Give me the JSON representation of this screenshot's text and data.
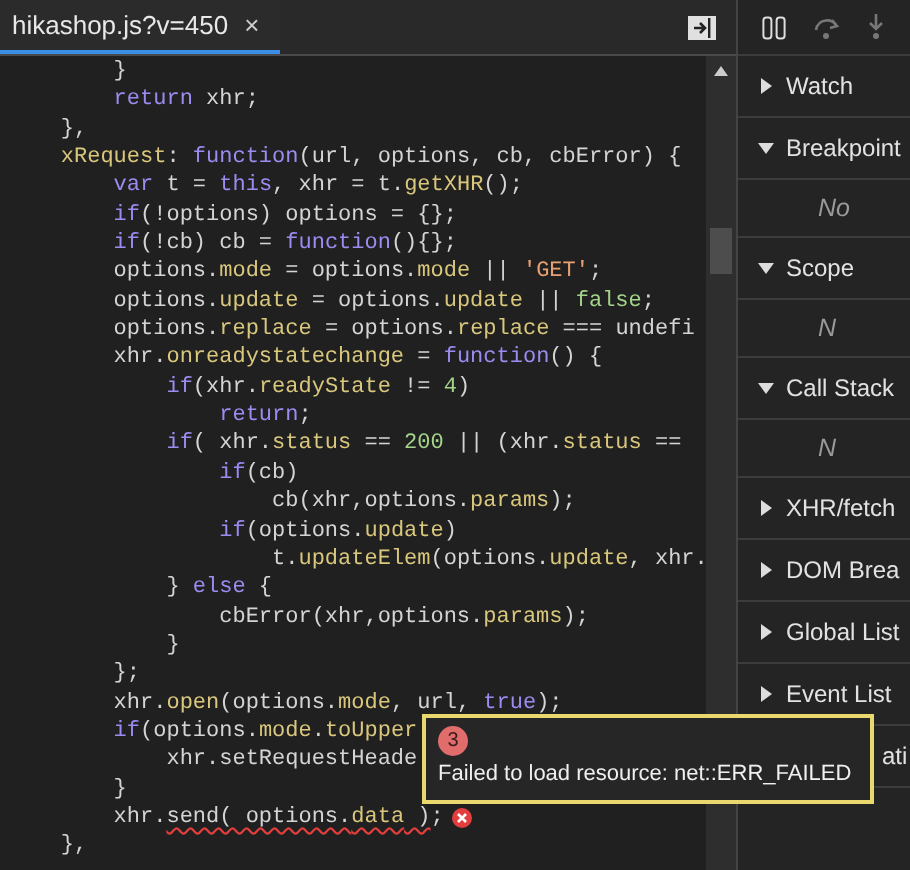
{
  "tab": {
    "label": "hikashop.js?v=450",
    "close": "×",
    "selected": true
  },
  "code": [
    {
      "tokens": [
        {
          "kind": "plain",
          "text": "        }"
        }
      ]
    },
    {
      "tokens": [
        {
          "kind": "keyword",
          "text": "        return"
        },
        {
          "kind": "plain",
          "text": " xhr;"
        }
      ]
    },
    {
      "tokens": [
        {
          "kind": "plain",
          "text": "    },"
        }
      ]
    },
    {
      "tokens": [
        {
          "kind": "member",
          "text": "    xRequest"
        },
        {
          "kind": "plain",
          "text": ": "
        },
        {
          "kind": "keyword",
          "text": "function"
        },
        {
          "kind": "plain",
          "text": "(url, options, cb, cbError) {"
        }
      ]
    },
    {
      "tokens": [
        {
          "kind": "keyword",
          "text": "        var"
        },
        {
          "kind": "plain",
          "text": " t = "
        },
        {
          "kind": "keyword",
          "text": "this"
        },
        {
          "kind": "plain",
          "text": ", xhr = t."
        },
        {
          "kind": "member",
          "text": "getXHR"
        },
        {
          "kind": "plain",
          "text": "();"
        }
      ]
    },
    {
      "tokens": [
        {
          "kind": "keyword",
          "text": "        if"
        },
        {
          "kind": "plain",
          "text": "(!options) options = {};"
        }
      ]
    },
    {
      "tokens": [
        {
          "kind": "keyword",
          "text": "        if"
        },
        {
          "kind": "plain",
          "text": "(!cb) cb = "
        },
        {
          "kind": "keyword",
          "text": "function"
        },
        {
          "kind": "plain",
          "text": "(){};"
        }
      ]
    },
    {
      "tokens": [
        {
          "kind": "plain",
          "text": "        options."
        },
        {
          "kind": "member",
          "text": "mode"
        },
        {
          "kind": "plain",
          "text": " = options."
        },
        {
          "kind": "member",
          "text": "mode"
        },
        {
          "kind": "plain",
          "text": " || "
        },
        {
          "kind": "string",
          "text": "'GET'"
        },
        {
          "kind": "plain",
          "text": ";"
        }
      ]
    },
    {
      "tokens": [
        {
          "kind": "plain",
          "text": "        options."
        },
        {
          "kind": "member",
          "text": "update"
        },
        {
          "kind": "plain",
          "text": " = options."
        },
        {
          "kind": "member",
          "text": "update"
        },
        {
          "kind": "plain",
          "text": " || "
        },
        {
          "kind": "literal",
          "text": "false"
        },
        {
          "kind": "plain",
          "text": ";"
        }
      ]
    },
    {
      "tokens": [
        {
          "kind": "plain",
          "text": "        options."
        },
        {
          "kind": "member",
          "text": "replace"
        },
        {
          "kind": "plain",
          "text": " = options."
        },
        {
          "kind": "member",
          "text": "replace"
        },
        {
          "kind": "plain",
          "text": " === undefi"
        }
      ]
    },
    {
      "tokens": [
        {
          "kind": "plain",
          "text": "        xhr."
        },
        {
          "kind": "member",
          "text": "onreadystatechange"
        },
        {
          "kind": "plain",
          "text": " = "
        },
        {
          "kind": "keyword",
          "text": "function"
        },
        {
          "kind": "plain",
          "text": "() {"
        }
      ]
    },
    {
      "tokens": [
        {
          "kind": "keyword",
          "text": "            if"
        },
        {
          "kind": "plain",
          "text": "(xhr."
        },
        {
          "kind": "member",
          "text": "readyState"
        },
        {
          "kind": "plain",
          "text": " != "
        },
        {
          "kind": "literal",
          "text": "4"
        },
        {
          "kind": "plain",
          "text": ")"
        }
      ]
    },
    {
      "tokens": [
        {
          "kind": "keyword",
          "text": "                return"
        },
        {
          "kind": "plain",
          "text": ";"
        }
      ]
    },
    {
      "tokens": [
        {
          "kind": "keyword",
          "text": "            if"
        },
        {
          "kind": "plain",
          "text": "( xhr."
        },
        {
          "kind": "member",
          "text": "status"
        },
        {
          "kind": "plain",
          "text": " == "
        },
        {
          "kind": "literal",
          "text": "200"
        },
        {
          "kind": "plain",
          "text": " || (xhr."
        },
        {
          "kind": "member",
          "text": "status"
        },
        {
          "kind": "plain",
          "text": " =="
        }
      ]
    },
    {
      "tokens": [
        {
          "kind": "keyword",
          "text": "                if"
        },
        {
          "kind": "plain",
          "text": "(cb)"
        }
      ]
    },
    {
      "tokens": [
        {
          "kind": "plain",
          "text": "                    cb(xhr,options."
        },
        {
          "kind": "member",
          "text": "params"
        },
        {
          "kind": "plain",
          "text": ");"
        }
      ]
    },
    {
      "tokens": [
        {
          "kind": "keyword",
          "text": "                if"
        },
        {
          "kind": "plain",
          "text": "(options."
        },
        {
          "kind": "member",
          "text": "update"
        },
        {
          "kind": "plain",
          "text": ")"
        }
      ]
    },
    {
      "tokens": [
        {
          "kind": "plain",
          "text": "                    t."
        },
        {
          "kind": "member",
          "text": "updateElem"
        },
        {
          "kind": "plain",
          "text": "(options."
        },
        {
          "kind": "member",
          "text": "update"
        },
        {
          "kind": "plain",
          "text": ", xhr."
        }
      ]
    },
    {
      "tokens": [
        {
          "kind": "plain",
          "text": "            } "
        },
        {
          "kind": "keyword",
          "text": "else"
        },
        {
          "kind": "plain",
          "text": " {"
        }
      ]
    },
    {
      "tokens": [
        {
          "kind": "plain",
          "text": "                cbError(xhr,options."
        },
        {
          "kind": "member",
          "text": "params"
        },
        {
          "kind": "plain",
          "text": ");"
        }
      ]
    },
    {
      "tokens": [
        {
          "kind": "plain",
          "text": "            }"
        }
      ]
    },
    {
      "tokens": [
        {
          "kind": "plain",
          "text": "        };"
        }
      ]
    },
    {
      "tokens": [
        {
          "kind": "plain",
          "text": "        xhr."
        },
        {
          "kind": "member",
          "text": "open"
        },
        {
          "kind": "plain",
          "text": "(options."
        },
        {
          "kind": "member",
          "text": "mode"
        },
        {
          "kind": "plain",
          "text": ", url, "
        },
        {
          "kind": "keyword",
          "text": "true"
        },
        {
          "kind": "plain",
          "text": ");"
        }
      ]
    },
    {
      "tokens": [
        {
          "kind": "keyword",
          "text": "        if"
        },
        {
          "kind": "plain",
          "text": "(options."
        },
        {
          "kind": "member",
          "text": "mode"
        },
        {
          "kind": "plain",
          "text": "."
        },
        {
          "kind": "member",
          "text": "toUpper"
        }
      ]
    },
    {
      "tokens": [
        {
          "kind": "plain",
          "text": "            xhr.setRequestHeade"
        }
      ]
    },
    {
      "tokens": [
        {
          "kind": "plain",
          "text": "        }"
        }
      ]
    },
    {
      "tokens": [
        {
          "kind": "plain",
          "text": "        xhr."
        },
        {
          "kind": "error",
          "text": "send( options."
        },
        {
          "kind": "error_member",
          "text": "data"
        },
        {
          "kind": "error",
          "text": " )"
        },
        {
          "kind": "plain",
          "text": ";"
        }
      ],
      "error": true
    },
    {
      "tokens": [
        {
          "kind": "plain",
          "text": "    },"
        }
      ]
    }
  ],
  "tooltip": {
    "count": "3",
    "message": "Failed to load resource: net::ERR_FAILED"
  },
  "sections": [
    {
      "label": "Watch",
      "expanded": false
    },
    {
      "label": "Breakpoint",
      "expanded": true,
      "content": "No"
    },
    {
      "label": "Scope",
      "expanded": true,
      "content": "N"
    },
    {
      "label": "Call Stack",
      "expanded": true,
      "content": "N"
    },
    {
      "label": "XHR/fetch",
      "expanded": false
    },
    {
      "label": "DOM Brea",
      "expanded": false
    },
    {
      "label": "Global List",
      "expanded": false
    },
    {
      "label": "Event List",
      "expanded": false
    },
    {
      "label": "ati",
      "expanded": false,
      "covered": true
    }
  ]
}
